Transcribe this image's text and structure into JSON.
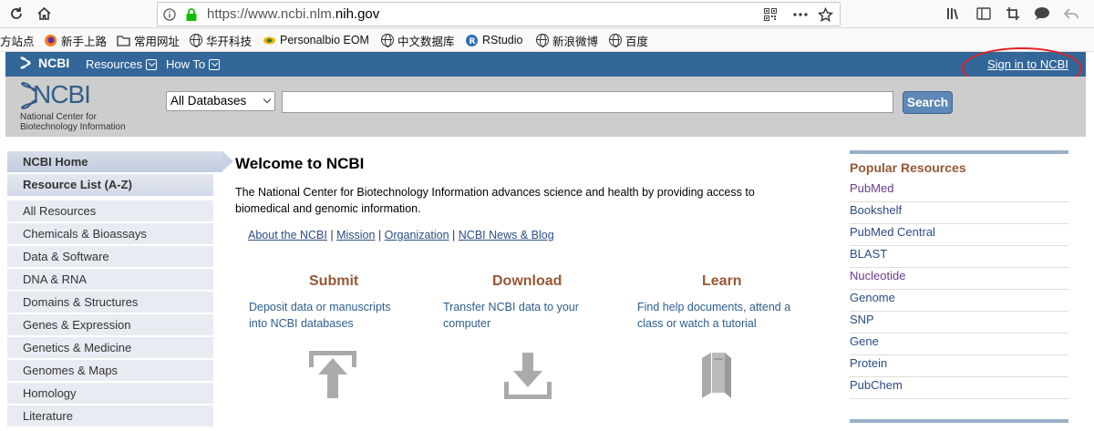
{
  "browser": {
    "url_prefix": "https://www.ncbi.nlm.",
    "url_domain": "nih.gov",
    "more_icon": "more-icon",
    "star_icon": "bookmark-star-icon"
  },
  "bookmarks": [
    {
      "label": "方站点",
      "icon": "none"
    },
    {
      "label": "新手上路",
      "icon": "firefox-icon"
    },
    {
      "label": "常用网址",
      "icon": "folder-icon"
    },
    {
      "label": "华开科技",
      "icon": "globe-icon"
    },
    {
      "label": "Personalbio EOM",
      "icon": "bio-icon"
    },
    {
      "label": "中文数据库",
      "icon": "globe-icon"
    },
    {
      "label": "RStudio",
      "icon": "rstudio-icon"
    },
    {
      "label": "新浪微博",
      "icon": "globe-icon"
    },
    {
      "label": "百度",
      "icon": "globe-icon"
    }
  ],
  "topbar": {
    "logo": "NCBI",
    "resources": "Resources",
    "howto": "How To",
    "signin": "Sign in to NCBI"
  },
  "header": {
    "logo_word": "NCBI",
    "logo_sub1": "National Center for",
    "logo_sub2": "Biotechnology Information",
    "db_select": "All Databases",
    "search_value": "",
    "search_button": "Search"
  },
  "sidebar": {
    "home": "NCBI Home",
    "resource_list": "Resource List (A-Z)",
    "items": [
      "All Resources",
      "Chemicals & Bioassays",
      "Data & Software",
      "DNA & RNA",
      "Domains & Structures",
      "Genes & Expression",
      "Genetics & Medicine",
      "Genomes & Maps",
      "Homology",
      "Literature"
    ]
  },
  "main": {
    "title": "Welcome to NCBI",
    "description": "The National Center for Biotechnology Information advances science and health by providing access to biomedical and genomic information.",
    "links": [
      "About the NCBI",
      "Mission",
      "Organization",
      "NCBI News & Blog"
    ],
    "separator": "|",
    "columns": [
      {
        "title": "Submit",
        "text1": "Deposit data or manuscripts",
        "text2": "into NCBI databases",
        "icon": "upload-icon"
      },
      {
        "title": "Download",
        "text1": "Transfer NCBI data to your",
        "text2": "computer",
        "icon": "download-icon"
      },
      {
        "title": "Learn",
        "text1": "Find help documents, attend a",
        "text2": "class or watch a tutorial",
        "icon": "books-icon"
      }
    ]
  },
  "popular": {
    "title": "Popular Resources",
    "items": [
      "PubMed",
      "Bookshelf",
      "PubMed Central",
      "BLAST",
      "Nucleotide",
      "Genome",
      "SNP",
      "Gene",
      "Protein",
      "PubChem"
    ]
  },
  "colors": {
    "topbar_blue": "#336699",
    "header_gray": "#cdcdcd",
    "heading_brown": "#985735",
    "link_blue": "#2b4c86",
    "annotation_red": "#e02020"
  }
}
